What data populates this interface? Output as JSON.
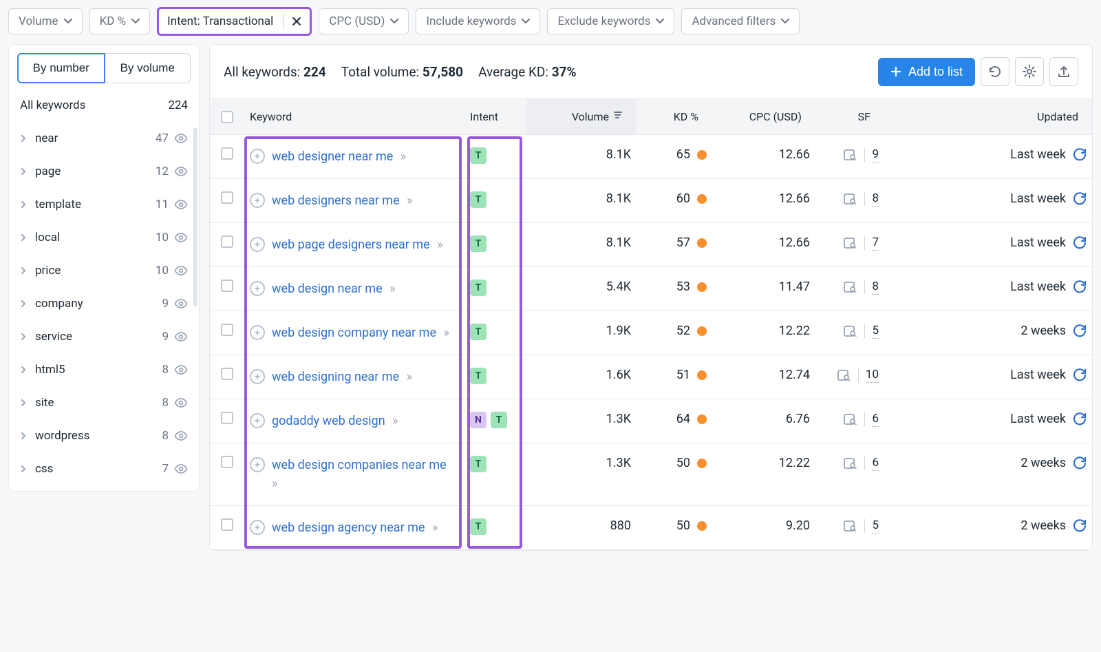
{
  "filters": {
    "volume": "Volume",
    "kd": "KD %",
    "intent_label": "Intent: Transactional",
    "cpc": "CPC (USD)",
    "include": "Include keywords",
    "exclude": "Exclude keywords",
    "advanced": "Advanced filters"
  },
  "sidebar": {
    "toggle": {
      "by_number": "By number",
      "by_volume": "By volume"
    },
    "all_keywords_label": "All keywords",
    "all_keywords_count": "224",
    "items": [
      {
        "label": "near",
        "count": "47"
      },
      {
        "label": "page",
        "count": "12"
      },
      {
        "label": "template",
        "count": "11"
      },
      {
        "label": "local",
        "count": "10"
      },
      {
        "label": "price",
        "count": "10"
      },
      {
        "label": "company",
        "count": "9"
      },
      {
        "label": "service",
        "count": "9"
      },
      {
        "label": "html5",
        "count": "8"
      },
      {
        "label": "site",
        "count": "8"
      },
      {
        "label": "wordpress",
        "count": "8"
      },
      {
        "label": "css",
        "count": "7"
      }
    ]
  },
  "summary": {
    "all_keywords_label": "All keywords:",
    "all_keywords_value": "224",
    "total_volume_label": "Total volume:",
    "total_volume_value": "57,580",
    "avg_kd_label": "Average KD:",
    "avg_kd_value": "37%"
  },
  "actions": {
    "add_to_list": "Add to list"
  },
  "columns": {
    "keyword": "Keyword",
    "intent": "Intent",
    "volume": "Volume",
    "kd": "KD %",
    "cpc": "CPC (USD)",
    "sf": "SF",
    "updated": "Updated"
  },
  "rows": [
    {
      "keyword": "web designer near me",
      "intents": [
        "T"
      ],
      "volume": "8.1K",
      "kd": "65",
      "cpc": "12.66",
      "sf": "9",
      "updated": "Last week"
    },
    {
      "keyword": "web designers near me",
      "intents": [
        "T"
      ],
      "volume": "8.1K",
      "kd": "60",
      "cpc": "12.66",
      "sf": "8",
      "updated": "Last week"
    },
    {
      "keyword": "web page designers near me",
      "intents": [
        "T"
      ],
      "volume": "8.1K",
      "kd": "57",
      "cpc": "12.66",
      "sf": "7",
      "updated": "Last week"
    },
    {
      "keyword": "web design near me",
      "intents": [
        "T"
      ],
      "volume": "5.4K",
      "kd": "53",
      "cpc": "11.47",
      "sf": "8",
      "updated": "Last week"
    },
    {
      "keyword": "web design company near me",
      "intents": [
        "T"
      ],
      "volume": "1.9K",
      "kd": "52",
      "cpc": "12.22",
      "sf": "5",
      "updated": "2 weeks"
    },
    {
      "keyword": "web designing near me",
      "intents": [
        "T"
      ],
      "volume": "1.6K",
      "kd": "51",
      "cpc": "12.74",
      "sf": "10",
      "updated": "Last week"
    },
    {
      "keyword": "godaddy web design",
      "intents": [
        "N",
        "T"
      ],
      "volume": "1.3K",
      "kd": "64",
      "cpc": "6.76",
      "sf": "6",
      "updated": "Last week"
    },
    {
      "keyword": "web design companies near me",
      "intents": [
        "T"
      ],
      "volume": "1.3K",
      "kd": "50",
      "cpc": "12.22",
      "sf": "6",
      "updated": "2 weeks"
    },
    {
      "keyword": "web design agency near me",
      "intents": [
        "T"
      ],
      "volume": "880",
      "kd": "50",
      "cpc": "9.20",
      "sf": "5",
      "updated": "2 weeks"
    }
  ]
}
